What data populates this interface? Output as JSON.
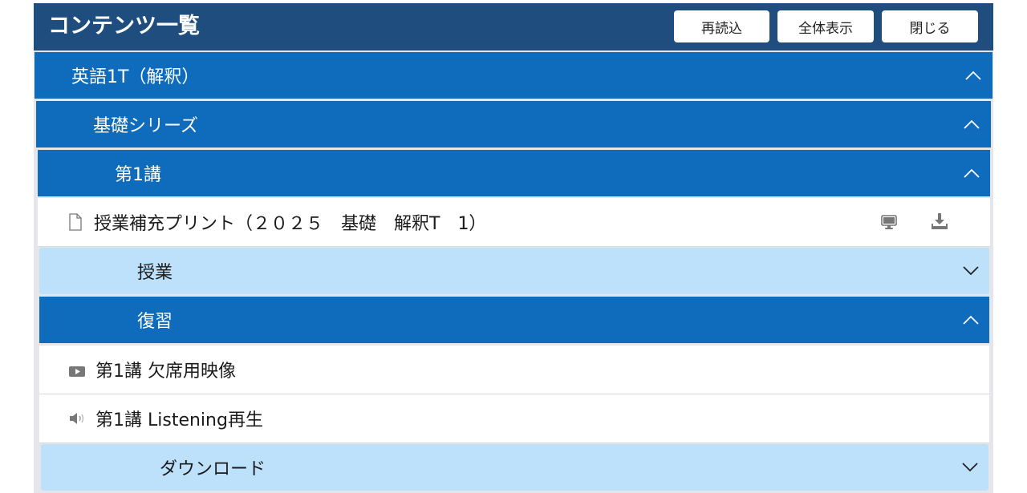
{
  "header": {
    "title": "コンテンツ一覧",
    "buttons": {
      "reload": "再読込",
      "show_all": "全体表示",
      "close": "閉じる"
    }
  },
  "tree": {
    "course": {
      "label": "英語1T（解釈）",
      "state": "expanded",
      "icon": "chevron-up-icon"
    },
    "series": {
      "label": "基礎シリーズ",
      "state": "expanded",
      "icon": "chevron-up-icon"
    },
    "lesson": {
      "label": "第1講",
      "state": "expanded",
      "icon": "chevron-up-icon"
    },
    "print_item": {
      "label": "授業補充プリント（２０２５　基礎　解釈T　1）",
      "icon": "document-icon",
      "actions": [
        "monitor-icon",
        "download-icon"
      ]
    },
    "class_section": {
      "label": "授業",
      "state": "collapsed",
      "icon": "chevron-down-icon"
    },
    "review_section": {
      "label": "復習",
      "state": "expanded",
      "icon": "chevron-up-icon"
    },
    "video_item": {
      "label": "第1講 欠席用映像",
      "icon": "video-icon"
    },
    "audio_item": {
      "label": "第1講 Listening再生",
      "icon": "speaker-icon"
    },
    "download_section": {
      "label": "ダウンロード",
      "state": "collapsed",
      "icon": "chevron-down-icon"
    }
  },
  "colors": {
    "header_bg": "#1f4e7e",
    "expanded_row_bg": "#0f6cbd",
    "collapsed_row_bg": "#bde0fb",
    "item_row_bg": "#ffffff",
    "panel_bg": "#e4e6ea"
  }
}
